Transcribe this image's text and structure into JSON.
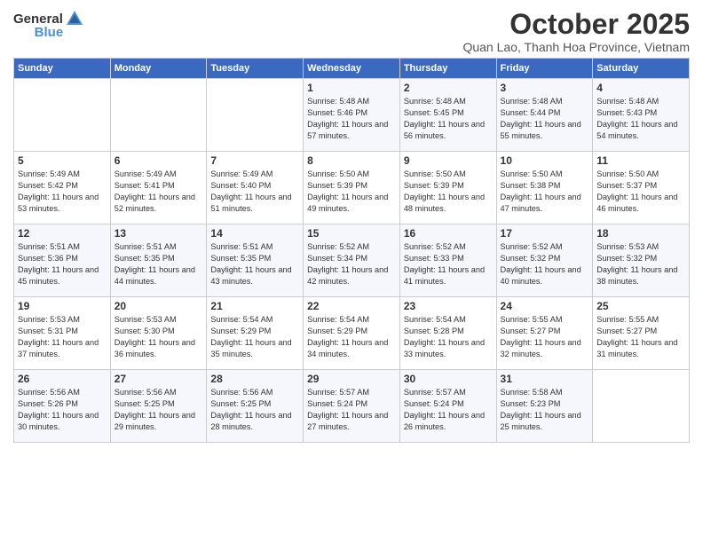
{
  "logo": {
    "general": "General",
    "blue": "Blue"
  },
  "title": "October 2025",
  "subtitle": "Quan Lao, Thanh Hoa Province, Vietnam",
  "headers": [
    "Sunday",
    "Monday",
    "Tuesday",
    "Wednesday",
    "Thursday",
    "Friday",
    "Saturday"
  ],
  "weeks": [
    [
      {
        "day": "",
        "sunrise": "",
        "sunset": "",
        "daylight": ""
      },
      {
        "day": "",
        "sunrise": "",
        "sunset": "",
        "daylight": ""
      },
      {
        "day": "",
        "sunrise": "",
        "sunset": "",
        "daylight": ""
      },
      {
        "day": "1",
        "sunrise": "Sunrise: 5:48 AM",
        "sunset": "Sunset: 5:46 PM",
        "daylight": "Daylight: 11 hours and 57 minutes."
      },
      {
        "day": "2",
        "sunrise": "Sunrise: 5:48 AM",
        "sunset": "Sunset: 5:45 PM",
        "daylight": "Daylight: 11 hours and 56 minutes."
      },
      {
        "day": "3",
        "sunrise": "Sunrise: 5:48 AM",
        "sunset": "Sunset: 5:44 PM",
        "daylight": "Daylight: 11 hours and 55 minutes."
      },
      {
        "day": "4",
        "sunrise": "Sunrise: 5:48 AM",
        "sunset": "Sunset: 5:43 PM",
        "daylight": "Daylight: 11 hours and 54 minutes."
      }
    ],
    [
      {
        "day": "5",
        "sunrise": "Sunrise: 5:49 AM",
        "sunset": "Sunset: 5:42 PM",
        "daylight": "Daylight: 11 hours and 53 minutes."
      },
      {
        "day": "6",
        "sunrise": "Sunrise: 5:49 AM",
        "sunset": "Sunset: 5:41 PM",
        "daylight": "Daylight: 11 hours and 52 minutes."
      },
      {
        "day": "7",
        "sunrise": "Sunrise: 5:49 AM",
        "sunset": "Sunset: 5:40 PM",
        "daylight": "Daylight: 11 hours and 51 minutes."
      },
      {
        "day": "8",
        "sunrise": "Sunrise: 5:50 AM",
        "sunset": "Sunset: 5:39 PM",
        "daylight": "Daylight: 11 hours and 49 minutes."
      },
      {
        "day": "9",
        "sunrise": "Sunrise: 5:50 AM",
        "sunset": "Sunset: 5:39 PM",
        "daylight": "Daylight: 11 hours and 48 minutes."
      },
      {
        "day": "10",
        "sunrise": "Sunrise: 5:50 AM",
        "sunset": "Sunset: 5:38 PM",
        "daylight": "Daylight: 11 hours and 47 minutes."
      },
      {
        "day": "11",
        "sunrise": "Sunrise: 5:50 AM",
        "sunset": "Sunset: 5:37 PM",
        "daylight": "Daylight: 11 hours and 46 minutes."
      }
    ],
    [
      {
        "day": "12",
        "sunrise": "Sunrise: 5:51 AM",
        "sunset": "Sunset: 5:36 PM",
        "daylight": "Daylight: 11 hours and 45 minutes."
      },
      {
        "day": "13",
        "sunrise": "Sunrise: 5:51 AM",
        "sunset": "Sunset: 5:35 PM",
        "daylight": "Daylight: 11 hours and 44 minutes."
      },
      {
        "day": "14",
        "sunrise": "Sunrise: 5:51 AM",
        "sunset": "Sunset: 5:35 PM",
        "daylight": "Daylight: 11 hours and 43 minutes."
      },
      {
        "day": "15",
        "sunrise": "Sunrise: 5:52 AM",
        "sunset": "Sunset: 5:34 PM",
        "daylight": "Daylight: 11 hours and 42 minutes."
      },
      {
        "day": "16",
        "sunrise": "Sunrise: 5:52 AM",
        "sunset": "Sunset: 5:33 PM",
        "daylight": "Daylight: 11 hours and 41 minutes."
      },
      {
        "day": "17",
        "sunrise": "Sunrise: 5:52 AM",
        "sunset": "Sunset: 5:32 PM",
        "daylight": "Daylight: 11 hours and 40 minutes."
      },
      {
        "day": "18",
        "sunrise": "Sunrise: 5:53 AM",
        "sunset": "Sunset: 5:32 PM",
        "daylight": "Daylight: 11 hours and 38 minutes."
      }
    ],
    [
      {
        "day": "19",
        "sunrise": "Sunrise: 5:53 AM",
        "sunset": "Sunset: 5:31 PM",
        "daylight": "Daylight: 11 hours and 37 minutes."
      },
      {
        "day": "20",
        "sunrise": "Sunrise: 5:53 AM",
        "sunset": "Sunset: 5:30 PM",
        "daylight": "Daylight: 11 hours and 36 minutes."
      },
      {
        "day": "21",
        "sunrise": "Sunrise: 5:54 AM",
        "sunset": "Sunset: 5:29 PM",
        "daylight": "Daylight: 11 hours and 35 minutes."
      },
      {
        "day": "22",
        "sunrise": "Sunrise: 5:54 AM",
        "sunset": "Sunset: 5:29 PM",
        "daylight": "Daylight: 11 hours and 34 minutes."
      },
      {
        "day": "23",
        "sunrise": "Sunrise: 5:54 AM",
        "sunset": "Sunset: 5:28 PM",
        "daylight": "Daylight: 11 hours and 33 minutes."
      },
      {
        "day": "24",
        "sunrise": "Sunrise: 5:55 AM",
        "sunset": "Sunset: 5:27 PM",
        "daylight": "Daylight: 11 hours and 32 minutes."
      },
      {
        "day": "25",
        "sunrise": "Sunrise: 5:55 AM",
        "sunset": "Sunset: 5:27 PM",
        "daylight": "Daylight: 11 hours and 31 minutes."
      }
    ],
    [
      {
        "day": "26",
        "sunrise": "Sunrise: 5:56 AM",
        "sunset": "Sunset: 5:26 PM",
        "daylight": "Daylight: 11 hours and 30 minutes."
      },
      {
        "day": "27",
        "sunrise": "Sunrise: 5:56 AM",
        "sunset": "Sunset: 5:25 PM",
        "daylight": "Daylight: 11 hours and 29 minutes."
      },
      {
        "day": "28",
        "sunrise": "Sunrise: 5:56 AM",
        "sunset": "Sunset: 5:25 PM",
        "daylight": "Daylight: 11 hours and 28 minutes."
      },
      {
        "day": "29",
        "sunrise": "Sunrise: 5:57 AM",
        "sunset": "Sunset: 5:24 PM",
        "daylight": "Daylight: 11 hours and 27 minutes."
      },
      {
        "day": "30",
        "sunrise": "Sunrise: 5:57 AM",
        "sunset": "Sunset: 5:24 PM",
        "daylight": "Daylight: 11 hours and 26 minutes."
      },
      {
        "day": "31",
        "sunrise": "Sunrise: 5:58 AM",
        "sunset": "Sunset: 5:23 PM",
        "daylight": "Daylight: 11 hours and 25 minutes."
      },
      {
        "day": "",
        "sunrise": "",
        "sunset": "",
        "daylight": ""
      }
    ]
  ]
}
